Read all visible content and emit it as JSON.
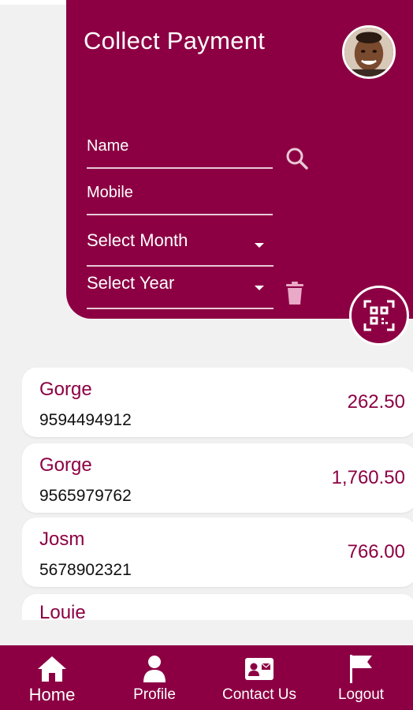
{
  "header": {
    "title": "Collect Payment"
  },
  "form": {
    "name_placeholder": "Name",
    "mobile_placeholder": "Mobile",
    "month_select": "Select Month",
    "year_select": "Select Year"
  },
  "records": [
    {
      "name": "Gorge",
      "mobile": "9594494912",
      "amount": "262.50"
    },
    {
      "name": "Gorge",
      "mobile": "9565979762",
      "amount": "1,760.50"
    },
    {
      "name": "Josm",
      "mobile": "5678902321",
      "amount": "766.00"
    },
    {
      "name": "Louie",
      "mobile": "",
      "amount": ""
    }
  ],
  "nav": {
    "home": "Home",
    "profile": "Profile",
    "contact": "Contact Us",
    "logout": "Logout"
  },
  "colors": {
    "primary": "#8c0043",
    "background": "#f2f1f2",
    "card": "#ffffff"
  },
  "icons": {
    "search": "search-icon",
    "trash": "trash-icon",
    "scan": "qr-scan-icon",
    "home": "home-icon",
    "profile": "person-icon",
    "contact": "contact-card-icon",
    "logout": "flag-icon"
  }
}
